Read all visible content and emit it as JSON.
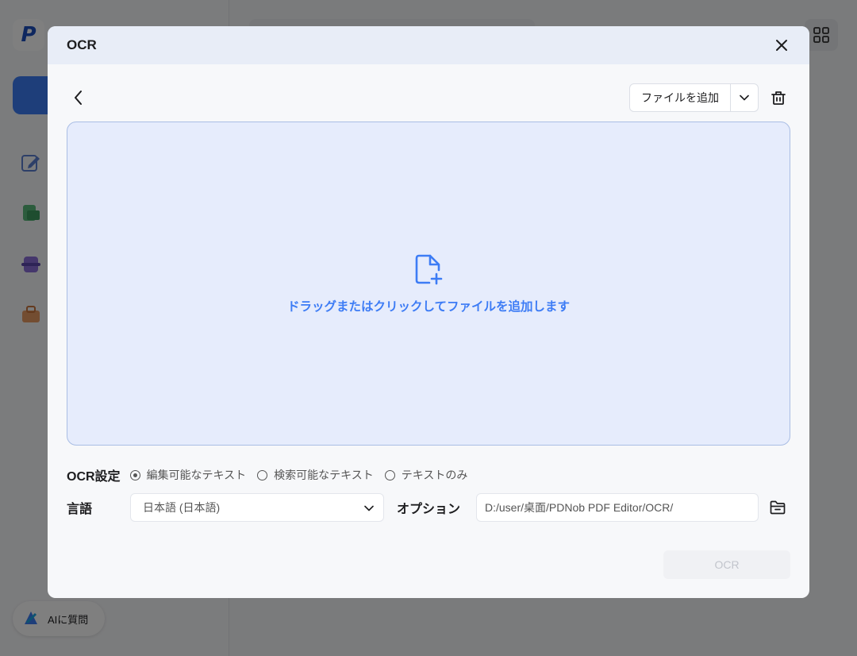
{
  "background": {
    "logo_letter": "P",
    "ai_button_label": "AIに質問"
  },
  "modal": {
    "title": "OCR",
    "add_file_label": "ファイルを追加",
    "dropzone_text": "ドラッグまたはクリックしてファイルを追加します",
    "ocr_settings_label": "OCR設定",
    "ocr_options": [
      {
        "label": "編集可能なテキスト",
        "selected": true
      },
      {
        "label": "検索可能なテキスト",
        "selected": false
      },
      {
        "label": "テキストのみ",
        "selected": false
      }
    ],
    "language_label": "言語",
    "language_value": "日本語 (日本語)",
    "option_label": "オプション",
    "output_path": "D:/user/桌面/PDNob PDF Editor/OCR/",
    "ocr_button_label": "OCR"
  },
  "colors": {
    "accent": "#3d7cf5",
    "dropzone_bg": "#e6ecfc",
    "header_bg": "#e8edf7"
  },
  "icons": {
    "close": "close-icon",
    "back": "chevron-left-icon",
    "dropdown": "chevron-down-icon",
    "trash": "trash-icon",
    "add_file": "file-plus-icon",
    "folder": "folder-icon"
  }
}
